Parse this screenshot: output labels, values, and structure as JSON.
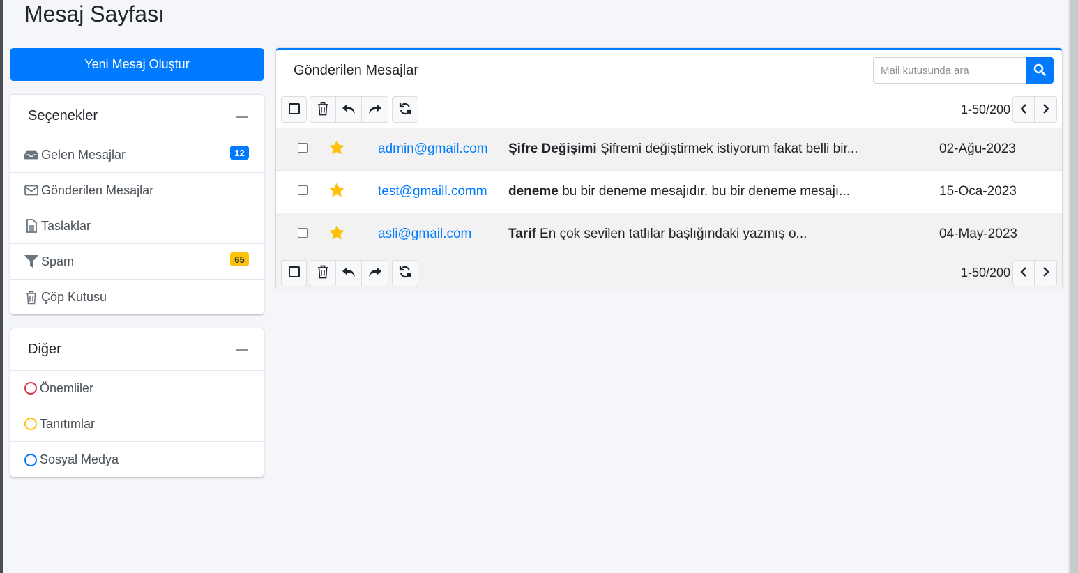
{
  "page": {
    "title": "Mesaj Sayfası"
  },
  "compose": {
    "label": "Yeni Mesaj Oluştur"
  },
  "options": {
    "title": "Seçenekler",
    "items": [
      {
        "label": "Gelen Mesajlar",
        "icon": "inbox-icon",
        "badge": "12",
        "badge_color": "#007bff"
      },
      {
        "label": "Gönderilen Mesajlar",
        "icon": "envelope-icon"
      },
      {
        "label": "Taslaklar",
        "icon": "file-icon"
      },
      {
        "label": "Spam",
        "icon": "filter-icon",
        "badge": "65",
        "badge_color": "#ffc107"
      },
      {
        "label": "Çöp Kutusu",
        "icon": "trash-icon"
      }
    ]
  },
  "other": {
    "title": "Diğer",
    "items": [
      {
        "label": "Önemliler",
        "icon": "circle-icon",
        "color": "#dc3545"
      },
      {
        "label": "Tanıtımlar",
        "icon": "circle-icon",
        "color": "#ffc107"
      },
      {
        "label": "Sosyal Medya",
        "icon": "circle-icon",
        "color": "#007bff"
      }
    ]
  },
  "mailbox": {
    "title": "Gönderilen Mesajlar",
    "search_placeholder": "Mail kutusunda ara",
    "pager": "1-50/200",
    "messages": [
      {
        "sender": "admin@gmail.com",
        "subject": "Şifre Değişimi",
        "preview": "Şifremi değiştirmek istiyorum fakat belli bir...",
        "date": "02-Ağu-2023",
        "starred": true
      },
      {
        "sender": "test@gmaill.comm",
        "subject": "deneme",
        "preview": "bu bir deneme mesajıdır. bu bir deneme mesajı...",
        "date": "15-Oca-2023",
        "starred": true
      },
      {
        "sender": "asli@gmail.com",
        "subject": "Tarif",
        "preview": "En çok sevilen tatlılar başlığındaki yazmış o...",
        "date": "04-May-2023",
        "starred": true
      }
    ]
  },
  "colors": {
    "primary": "#007bff",
    "star": "#ffc107",
    "danger": "#dc3545"
  }
}
